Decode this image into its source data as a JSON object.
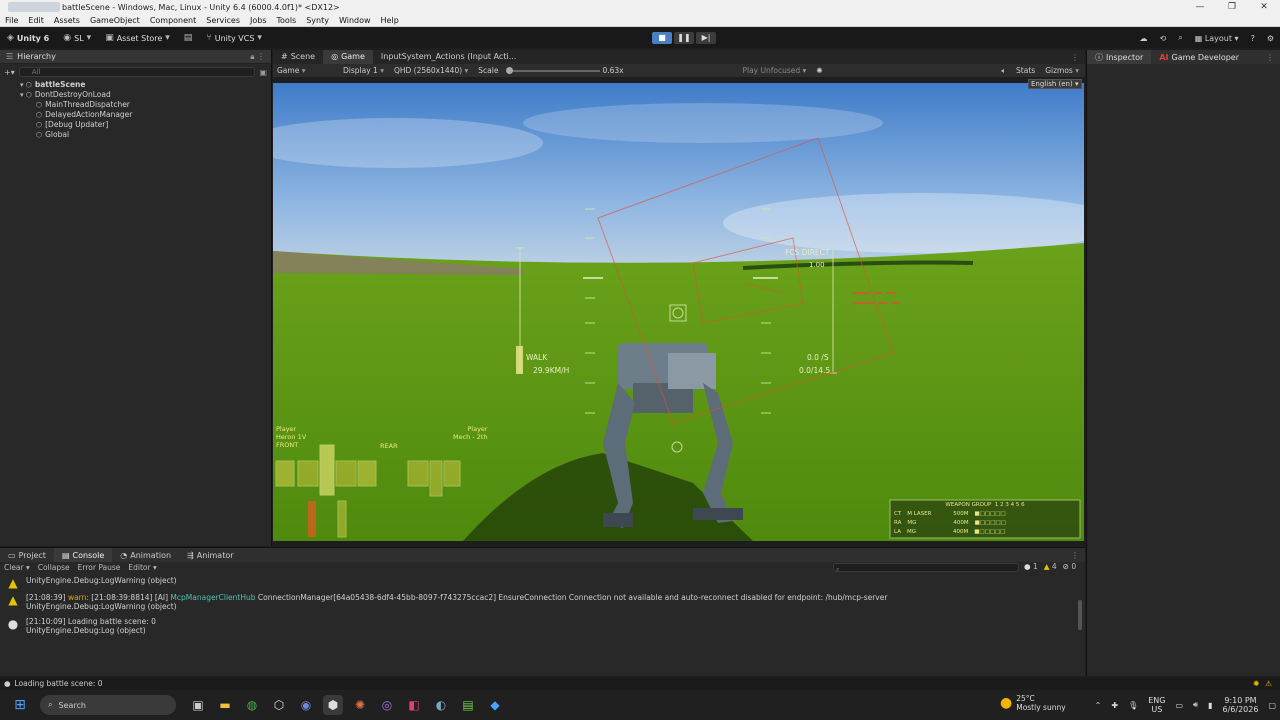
{
  "window": {
    "title": "battleScene - Windows, Mac, Linux - Unity 6.4 (6000.4.0f1)* <DX12>",
    "controls": [
      "—",
      "❐",
      "✕"
    ]
  },
  "menu": [
    "File",
    "Edit",
    "Assets",
    "GameObject",
    "Component",
    "Services",
    "Jobs",
    "Tools",
    "Synty",
    "Window",
    "Help"
  ],
  "toolbar": {
    "unity": "Unity 6",
    "account": "SL",
    "asset_store": "Asset Store",
    "vcs": "Unity VCS",
    "layout": "Layout"
  },
  "hierarchy": {
    "tab": "Hierarchy",
    "search_placeholder": "All",
    "rows": [
      {
        "label": "battleScene",
        "indent": 0,
        "bold": true
      },
      {
        "label": "DontDestroyOnLoad",
        "indent": 0,
        "bold": false
      },
      {
        "label": "MainThreadDispatcher",
        "indent": 1,
        "bold": false
      },
      {
        "label": "DelayedActionManager",
        "indent": 1,
        "bold": false
      },
      {
        "label": "[Debug Updater]",
        "indent": 1,
        "bold": false
      },
      {
        "label": "Global",
        "indent": 1,
        "bold": false
      }
    ]
  },
  "center_tabs": {
    "scene": "Scene",
    "game": "Game",
    "input": "InputSystem_Actions (Input Acti..."
  },
  "game_bar": {
    "mode": "Game",
    "display": "Display 1",
    "resolution": "QHD (2560x1440)",
    "scale_label": "Scale",
    "scale_value": "0.63x",
    "play_focus": "Play Unfocused",
    "stats": "Stats",
    "gizmos": "Gizmos",
    "language": "English (en)"
  },
  "hud": {
    "mode_label": "FCS DIRECT",
    "mode_value": "1.00",
    "speed_mode": "WALK",
    "speed_value": "29.9KM/H",
    "rate": "0.0 /S",
    "ammo": "0.0/14.5",
    "player_left_1": "Player",
    "player_left_2": "Heron 1V",
    "front": "FRONT",
    "rear": "REAR",
    "player_right_1": "Player",
    "player_right_2": "Mech - 2th",
    "weapon_group": "WEAPON GROUP",
    "weapons": [
      {
        "slot": "CT",
        "name": "M LASER",
        "range": "500M"
      },
      {
        "slot": "RA",
        "name": "MG",
        "range": "400M"
      },
      {
        "slot": "LA",
        "name": "MG",
        "range": "400M"
      }
    ]
  },
  "inspector": {
    "tab": "Inspector",
    "ai_tab": "Game Developer",
    "ai_badge": "AI"
  },
  "bottom_tabs": [
    "Project",
    "Console",
    "Animation",
    "Animator"
  ],
  "console_toolbar": {
    "clear": "Clear",
    "collapse": "Collapse",
    "error_pause": "Error Pause",
    "editor": "Editor",
    "count_info": "1",
    "count_warn": "4",
    "count_err": "0"
  },
  "logs": [
    {
      "type": "warn",
      "line1": "UnityEngine.Debug:LogWarning (object)",
      "line2": ""
    },
    {
      "type": "warn",
      "time": "[21:08:39]",
      "warn": "warn:",
      "rest1": "[21:08:39:8814] [AI]",
      "cls": "McpManagerClientHub",
      "rest2": "ConnectionManager[64a05438-6df4-45bb-8097-f743275ccac2] EnsureConnection Connection not available and auto-reconnect disabled for endpoint: /hub/mcp-server",
      "line2": "UnityEngine.Debug:LogWarning (object)"
    },
    {
      "type": "info",
      "line1": "[21:10:09] Loading battle scene: 0",
      "line2": "UnityEngine.Debug:Log (object)"
    }
  ],
  "status": "Loading battle scene: 0",
  "taskbar": {
    "search": "Search",
    "weather_temp": "25°C",
    "weather_desc": "Mostly sunny",
    "lang1": "ENG",
    "lang2": "US",
    "time": "9:10 PM",
    "date": "6/6/2026"
  }
}
